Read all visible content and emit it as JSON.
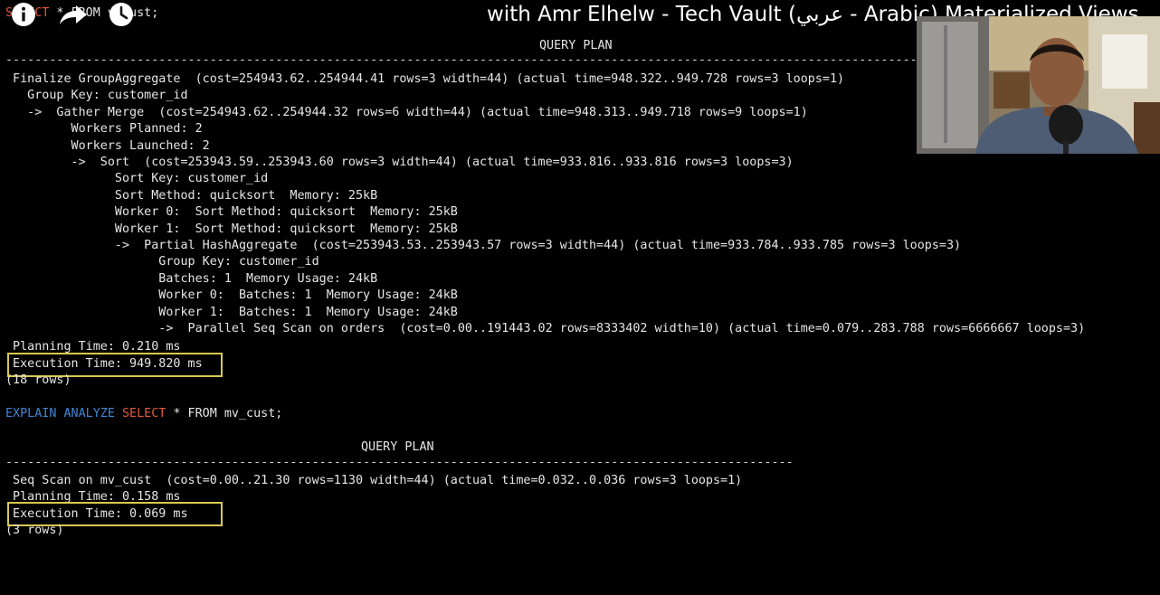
{
  "video": {
    "title": "with Amr Elhelw - Tech Vault (عربي - Arabic) Materialized Views"
  },
  "colors": {
    "background": "#000000",
    "text": "#e6e6e6",
    "keyword_blue": "#3f86d6",
    "keyword_red": "#e05a3c",
    "highlight": "#d9c850"
  },
  "icons": [
    "info-icon",
    "share-icon",
    "watch-later-icon"
  ],
  "query1": {
    "command_visible": "SELECT * FROM v_cust;",
    "kw_select": "SELECT",
    "rest": " * FROM v_cust;",
    "header": "QUERY PLAN",
    "plan": [
      " Finalize GroupAggregate  (cost=254943.62..254944.41 rows=3 width=44) (actual time=948.322..949.728 rows=3 loops=1)",
      "   Group Key: customer_id",
      "   ->  Gather Merge  (cost=254943.62..254944.32 rows=6 width=44) (actual time=948.313..949.718 rows=9 loops=1)",
      "         Workers Planned: 2",
      "         Workers Launched: 2",
      "         ->  Sort  (cost=253943.59..253943.60 rows=3 width=44) (actual time=933.816..933.816 rows=3 loops=3)",
      "               Sort Key: customer_id",
      "               Sort Method: quicksort  Memory: 25kB",
      "               Worker 0:  Sort Method: quicksort  Memory: 25kB",
      "               Worker 1:  Sort Method: quicksort  Memory: 25kB",
      "               ->  Partial HashAggregate  (cost=253943.53..253943.57 rows=3 width=44) (actual time=933.784..933.785 rows=3 loops=3)",
      "                     Group Key: customer_id",
      "                     Batches: 1  Memory Usage: 24kB",
      "                     Worker 0:  Batches: 1  Memory Usage: 24kB",
      "                     Worker 1:  Batches: 1  Memory Usage: 24kB",
      "                     ->  Parallel Seq Scan on orders  (cost=0.00..191443.02 rows=8333402 width=10) (actual time=0.079..283.788 rows=6666667 loops=3)"
    ],
    "planning_time": " Planning Time: 0.210 ms",
    "execution_time": " Execution Time: 949.820 ms",
    "row_count": "(18 rows)"
  },
  "query2": {
    "kw_explain": "EXPLAIN",
    "kw_analyze": "ANALYZE",
    "kw_select": "SELECT",
    "rest": " * FROM mv_cust;",
    "header": "QUERY PLAN",
    "plan": [
      " Seq Scan on mv_cust  (cost=0.00..21.30 rows=1130 width=44) (actual time=0.032..0.036 rows=3 loops=1)"
    ],
    "planning_time": " Planning Time: 0.158 ms",
    "execution_time": " Execution Time: 0.069 ms",
    "row_count": "(3 rows)"
  }
}
